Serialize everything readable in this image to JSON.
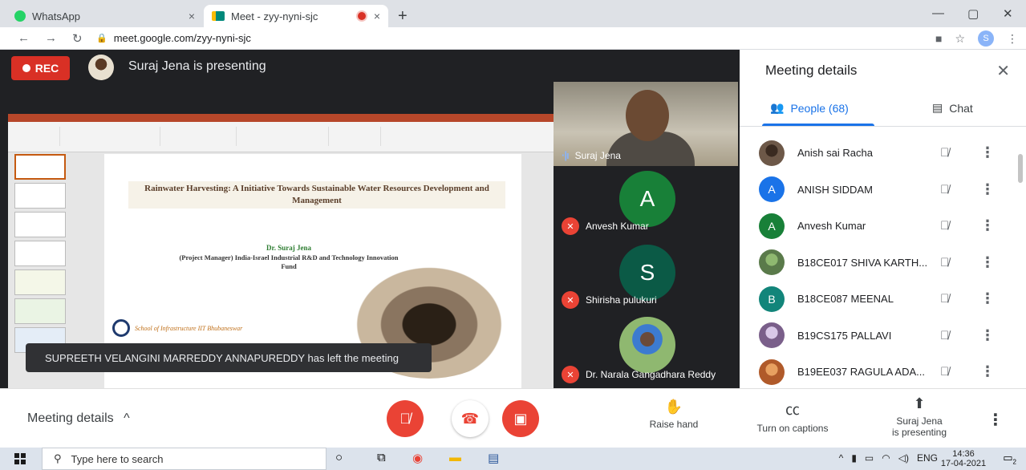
{
  "browser": {
    "tabs": [
      {
        "label": "WhatsApp",
        "close": "×"
      },
      {
        "label": "Meet - zyy-nyni-sjc",
        "close": "×"
      }
    ],
    "new_tab": "+",
    "url": "meet.google.com/zyy-nyni-sjc",
    "profile_initial": "S",
    "window_controls": [
      "—",
      "▢",
      "✕"
    ]
  },
  "stage": {
    "rec_label": "REC",
    "presenting_text": "Suraj Jena is presenting",
    "toast": "SUPREETH VELANGINI MARREDDY ANNAPUREDDY has left the meeting",
    "slide": {
      "title": "Rainwater Harvesting: A Initiative Towards Sustainable Water Resources Development and Management",
      "author": "Dr. Suraj Jena",
      "role_lines": "(Project Manager) India-Israel Industrial R&D and Technology Innovation Fund",
      "school": "School of Infrastructure IIT Bhubaneswar"
    }
  },
  "tiles": [
    {
      "name": "Suraj Jena",
      "type": "camera"
    },
    {
      "name": "Anvesh Kumar",
      "initial": "A",
      "color": "#188038"
    },
    {
      "name": "Shirisha pulukuri",
      "initial": "S",
      "color": "#0b5a46"
    },
    {
      "name": "Dr. Narala Gangadhara Reddy",
      "type": "photo"
    }
  ],
  "panel": {
    "title": "Meeting details",
    "tab_people": "People (68)",
    "tab_chat": "Chat",
    "participants": [
      {
        "name": "Anish sai Racha",
        "type": "photo",
        "color": "#6d5848"
      },
      {
        "name": "ANISH SIDDAM",
        "initial": "A",
        "color": "#1a73e8"
      },
      {
        "name": "Anvesh Kumar",
        "initial": "A",
        "color": "#188038"
      },
      {
        "name": "B18CE017 SHIVA KARTH...",
        "type": "photo",
        "color": "#5a7a4a"
      },
      {
        "name": "B18CE087 MEENAL",
        "initial": "B",
        "color": "#12857a"
      },
      {
        "name": "B19CS175 PALLAVI",
        "type": "photo",
        "color": "#7a5f8a"
      },
      {
        "name": "B19EE037 RAGULA ADA...",
        "type": "photo",
        "color": "#b05a2a"
      }
    ]
  },
  "bottom": {
    "meeting_details": "Meeting details",
    "raise_hand": "Raise hand",
    "captions": "Turn on captions",
    "presenting_line1": "Suraj Jena",
    "presenting_line2": "is presenting"
  },
  "taskbar": {
    "search_placeholder": "Type here to search",
    "lang": "ENG",
    "time": "14:36",
    "date": "17-04-2021",
    "notifications": "2"
  }
}
